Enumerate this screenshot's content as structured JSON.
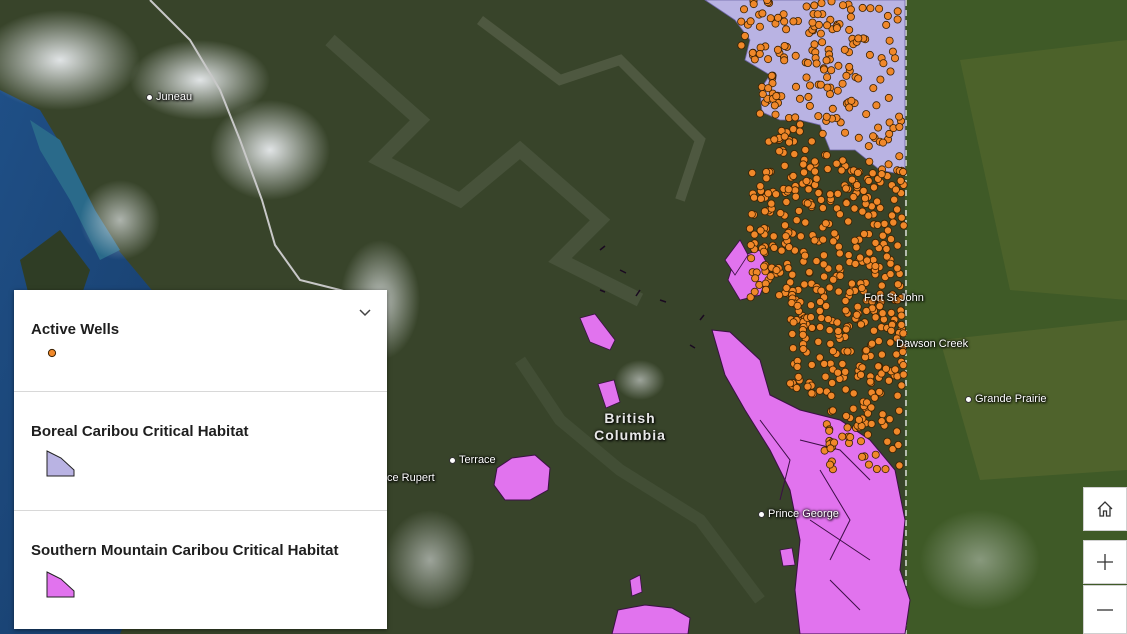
{
  "places": {
    "juneau": "Juneau",
    "terrace": "Terrace",
    "prince_rupert": "ce Rupert",
    "fort_st_john": "Fort St John",
    "dawson_creek": "Dawson Creek",
    "grande_prairie": "Grande Prairie",
    "prince_george": "Prince George"
  },
  "region_label": {
    "line1": "British",
    "line2": "Columbia"
  },
  "legend": {
    "layers": [
      {
        "title": "Active Wells",
        "symbol": "orange-point",
        "color": "#f0882a"
      },
      {
        "title": "Boreal Caribou Critical Habitat",
        "symbol": "lavender-polygon",
        "color": "#b9b3e3"
      },
      {
        "title": "Southern Mountain Caribou Critical Habitat",
        "symbol": "magenta-polygon",
        "color": "#e173ee"
      }
    ]
  },
  "controls": {
    "home": "home-icon",
    "zoom_in": "plus-icon",
    "zoom_out": "minus-icon"
  },
  "colors": {
    "wells": "#f0882a",
    "boreal": "#b9b3e3",
    "southern": "#e173ee"
  }
}
